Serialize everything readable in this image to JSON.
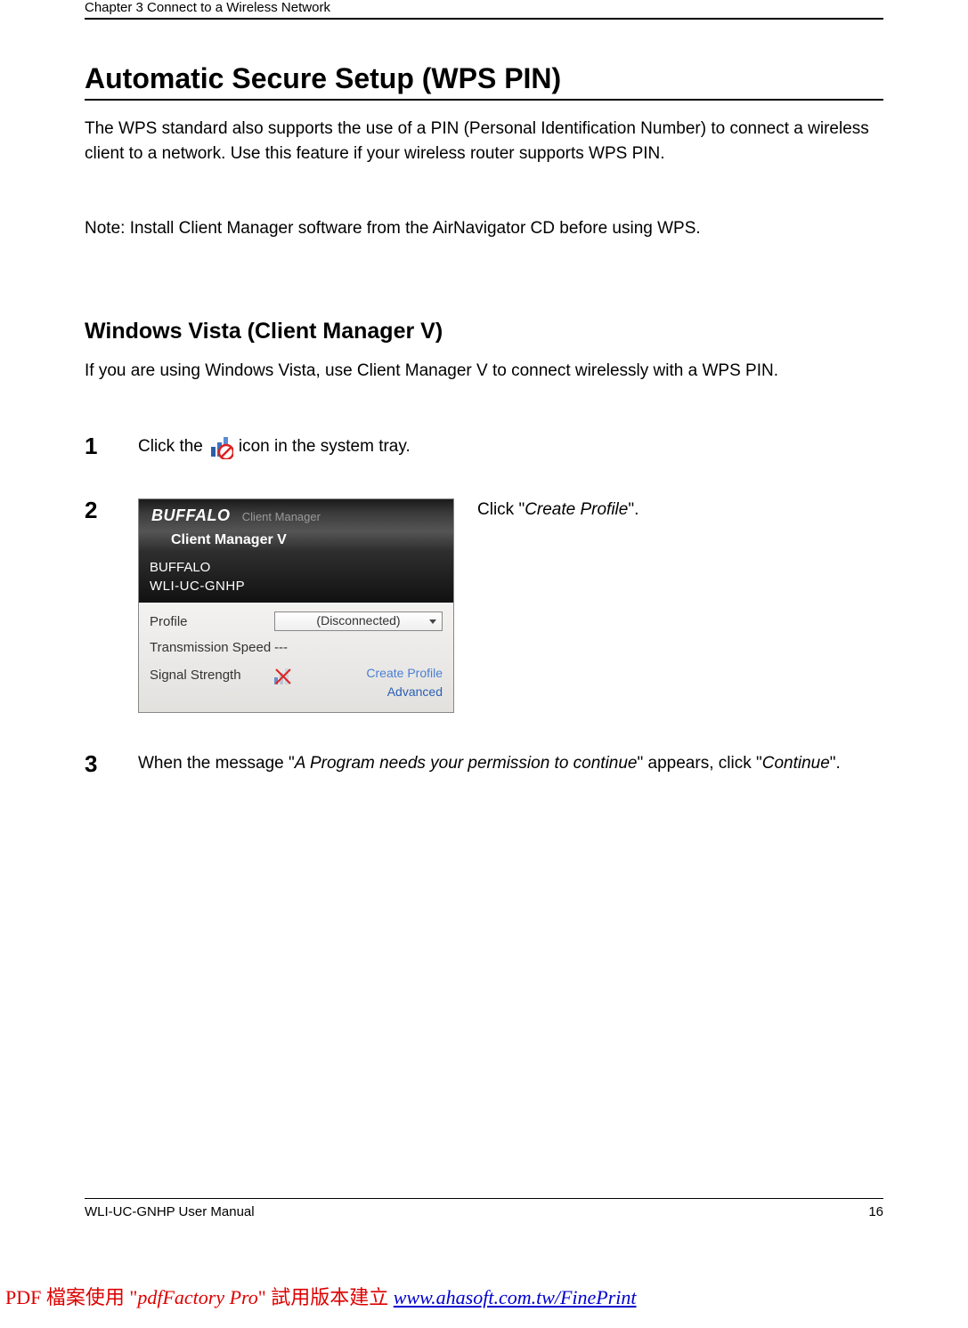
{
  "header": {
    "chapter": "Chapter 3  Connect to a Wireless Network"
  },
  "title": "Automatic Secure Setup (WPS PIN)",
  "intro_para": "The WPS standard also supports the use of a PIN (Personal Identification Number) to connect a wireless client to a network.  Use this feature if your wireless router supports WPS PIN.",
  "note": "Note:  Install Client Manager software from the AirNavigator CD before using WPS.",
  "section_title": "Windows Vista (Client Manager V)",
  "section_intro": "If you are using Windows Vista, use Client Manager V to connect wirelessly with a WPS PIN.",
  "steps": {
    "one": {
      "num": "1",
      "before": "Click the",
      "after": " icon in the system tray."
    },
    "two": {
      "num": "2",
      "instruction_prefix": "Click \"",
      "instruction_target": "Create Profile",
      "instruction_suffix": "\".",
      "cm": {
        "brand": "BUFFALO",
        "brand_sub": "Client Manager",
        "title": "Client Manager V",
        "vendor": "BUFFALO",
        "model": "WLI-UC-GNHP",
        "profile_label": "Profile",
        "profile_value": "(Disconnected)",
        "tx_label": "Transmission Speed",
        "tx_value": "---",
        "signal_label": "Signal Strength",
        "link_create": "Create Profile",
        "link_advanced": "Advanced"
      }
    },
    "three": {
      "num": "3",
      "t1": "When the message \"",
      "msg": "A Program needs your permission to continue",
      "t2": "\" appears, click \"",
      "btn": "Continue",
      "t3": "\"."
    }
  },
  "footer": {
    "manual": "WLI-UC-GNHP User Manual",
    "page": "16"
  },
  "watermark": {
    "p1": "PDF 檔案使用 \"",
    "p2": "pdfFactory Pro",
    "p3": "\" 試用版本建立 ",
    "url_text": "www.ahasoft.com.tw/FinePrint"
  }
}
